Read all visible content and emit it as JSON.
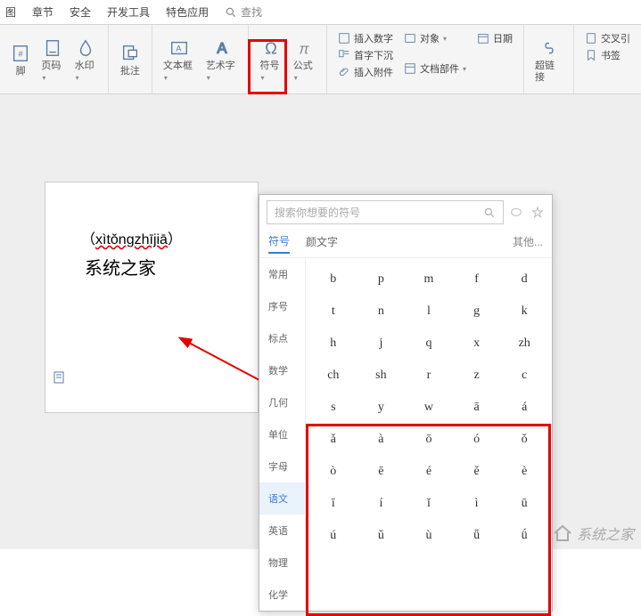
{
  "tabs": [
    "图",
    "章节",
    "安全",
    "开发工具",
    "特色应用"
  ],
  "search_placeholder": "查找",
  "ribbon": {
    "g1": [
      {
        "label": "脚",
        "icon": "hash"
      },
      {
        "label": "页码",
        "icon": "page",
        "dd": true
      },
      {
        "label": "水印",
        "icon": "water",
        "dd": true
      }
    ],
    "g2": [
      {
        "label": "批注",
        "icon": "annot"
      }
    ],
    "g3": [
      {
        "label": "文本框",
        "icon": "textbox",
        "dd": true
      },
      {
        "label": "艺术字",
        "icon": "art",
        "dd": true
      }
    ],
    "g4": [
      {
        "label": "符号",
        "icon": "omega",
        "dd": true
      },
      {
        "label": "公式",
        "icon": "pi",
        "dd": true
      }
    ],
    "g5r": [
      {
        "label": "插入数字",
        "icon": "num"
      },
      {
        "label": "首字下沉",
        "icon": "drop"
      },
      {
        "label": "插入附件",
        "icon": "attach"
      }
    ],
    "g5r2": [
      {
        "label": "对象",
        "icon": "obj",
        "dd": true
      },
      {
        "label": "",
        "icon": "",
        "dd": false
      },
      {
        "label": "文档部件",
        "icon": "parts",
        "dd": true
      }
    ],
    "g5r3": [
      {
        "label": "日期",
        "icon": "date"
      }
    ],
    "g6": [
      {
        "label": "超链接",
        "icon": "link"
      }
    ],
    "g7": [
      {
        "label": "交叉引",
        "icon": "xref"
      },
      {
        "label": "书签",
        "icon": "bookmark"
      }
    ]
  },
  "doc": {
    "pinyin_open": "（",
    "pinyin_text": "xìtǒngzhījiā",
    "pinyin_close": "）",
    "hanzi": "系统之家"
  },
  "popup": {
    "search_placeholder": "搜索你想要的符号",
    "tabs": [
      "符号",
      "颜文字"
    ],
    "other": "其他...",
    "categories": [
      "常用",
      "序号",
      "标点",
      "数学",
      "几何",
      "单位",
      "字母",
      "语文",
      "英语",
      "物理",
      "化学"
    ],
    "active_cat_index": 7,
    "grid": [
      [
        "b",
        "p",
        "m",
        "f",
        "d"
      ],
      [
        "t",
        "n",
        "l",
        "g",
        "k"
      ],
      [
        "h",
        "j",
        "q",
        "x",
        "zh"
      ],
      [
        "ch",
        "sh",
        "r",
        "z",
        "c"
      ],
      [
        "s",
        "y",
        "w",
        "ā",
        "á"
      ],
      [
        "ǎ",
        "à",
        "ō",
        "ó",
        "ǒ"
      ],
      [
        "ò",
        "ē",
        "é",
        "ě",
        "è"
      ],
      [
        "ī",
        "í",
        "ǐ",
        "ì",
        "ū"
      ],
      [
        "ú",
        "ǔ",
        "ù",
        "ǖ",
        "ǘ"
      ]
    ]
  },
  "watermark": "系统之家"
}
